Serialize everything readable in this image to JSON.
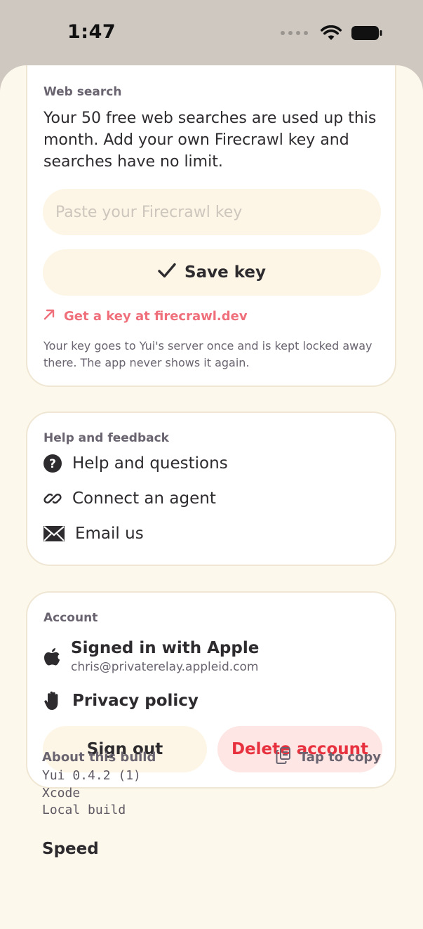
{
  "status_bar": {
    "time": "1:47"
  },
  "web_search": {
    "title": "Web search",
    "message": "Your 50 free web searches are used up this month. Add your own Firecrawl key and searches have no limit.",
    "key_placeholder": "Paste your Firecrawl key",
    "key_value": "",
    "save_label": "Save key",
    "link_label": "Get a key at firecrawl.dev",
    "note": "Your key goes to Yui's server once and is kept locked away there. The app never shows it again."
  },
  "help": {
    "title": "Help and feedback",
    "items": [
      {
        "label": "Help and questions",
        "icon": "question-circle-icon"
      },
      {
        "label": "Connect an agent",
        "icon": "link-icon"
      },
      {
        "label": "Email us",
        "icon": "envelope-icon"
      }
    ]
  },
  "account": {
    "title": "Account",
    "signed_in_label": "Signed in with Apple",
    "email": "chris@privaterelay.appleid.com",
    "privacy_label": "Privacy policy",
    "sign_out_label": "Sign out",
    "delete_label": "Delete account"
  },
  "about": {
    "title": "About this build",
    "copy_label": "Tap to copy",
    "lines": [
      "Yui 0.4.2 (1)",
      "Xcode",
      "Local build"
    ]
  },
  "speed": {
    "title": "Speed"
  },
  "colors": {
    "accent_link": "#ef6f7b",
    "danger": "#e8313f",
    "sheet_bg": "#fdf8ec"
  }
}
